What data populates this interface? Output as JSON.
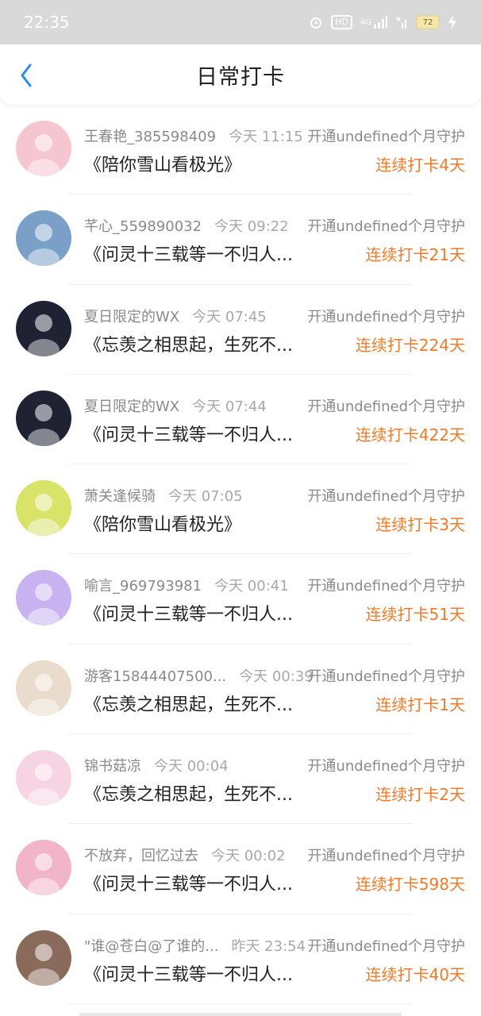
{
  "status_bar": {
    "time": "22:35",
    "hd": "HD",
    "network": "4G",
    "battery": "72"
  },
  "header": {
    "title": "日常打卡"
  },
  "items": [
    {
      "user": "王春艳_385598409",
      "time": "今天 11:15",
      "guard": "开通undefined个月守护",
      "content": "《陪你雪山看极光》",
      "streak": "连续打卡4天",
      "avatar_color": "#f6c6d0"
    },
    {
      "user": "芊心_559890032",
      "time": "今天 09:22",
      "guard": "开通undefined个月守护",
      "content": "《问灵十三载等一不归人...",
      "streak": "连续打卡21天",
      "avatar_color": "#7aa0c8"
    },
    {
      "user": "夏日限定的WX",
      "time": "今天 07:45",
      "guard": "开通undefined个月守护",
      "content": "《忘羡之相思起，生死不...",
      "streak": "连续打卡224天",
      "avatar_color": "#1e2233"
    },
    {
      "user": "夏日限定的WX",
      "time": "今天 07:44",
      "guard": "开通undefined个月守护",
      "content": "《问灵十三载等一不归人...",
      "streak": "连续打卡422天",
      "avatar_color": "#1e2233"
    },
    {
      "user": "萧关逢候骑",
      "time": "今天 07:05",
      "guard": "开通undefined个月守护",
      "content": "《陪你雪山看极光》",
      "streak": "连续打卡3天",
      "avatar_color": "#d8e36a"
    },
    {
      "user": "喻言_969793981",
      "time": "今天 00:41",
      "guard": "开通undefined个月守护",
      "content": "《问灵十三载等一不归人...",
      "streak": "连续打卡51天",
      "avatar_color": "#c9b2f0"
    },
    {
      "user": "游客15844407500...",
      "time": "今天 00:39",
      "guard": "开通undefined个月守护",
      "content": "《忘羡之相思起，生死不...",
      "streak": "连续打卡1天",
      "avatar_color": "#e9dccd"
    },
    {
      "user": "锦书菇凉",
      "time": "今天 00:04",
      "guard": "开通undefined个月守护",
      "content": "《忘羡之相思起，生死不...",
      "streak": "连续打卡2天",
      "avatar_color": "#f7d4e3"
    },
    {
      "user": "不放弃，回忆过去",
      "time": "今天 00:02",
      "guard": "开通undefined个月守护",
      "content": "《问灵十三载等一不归人...",
      "streak": "连续打卡598天",
      "avatar_color": "#f2b4c9"
    },
    {
      "user": "\"谁@苍白@了谁的...",
      "time": "昨天 23:54",
      "guard": "开通undefined个月守护",
      "content": "《问灵十三载等一不归人...",
      "streak": "连续打卡40天",
      "avatar_color": "#8a6a5a"
    }
  ],
  "colors": {
    "accent": "#2a8cf0",
    "streak": "#f07a28"
  }
}
